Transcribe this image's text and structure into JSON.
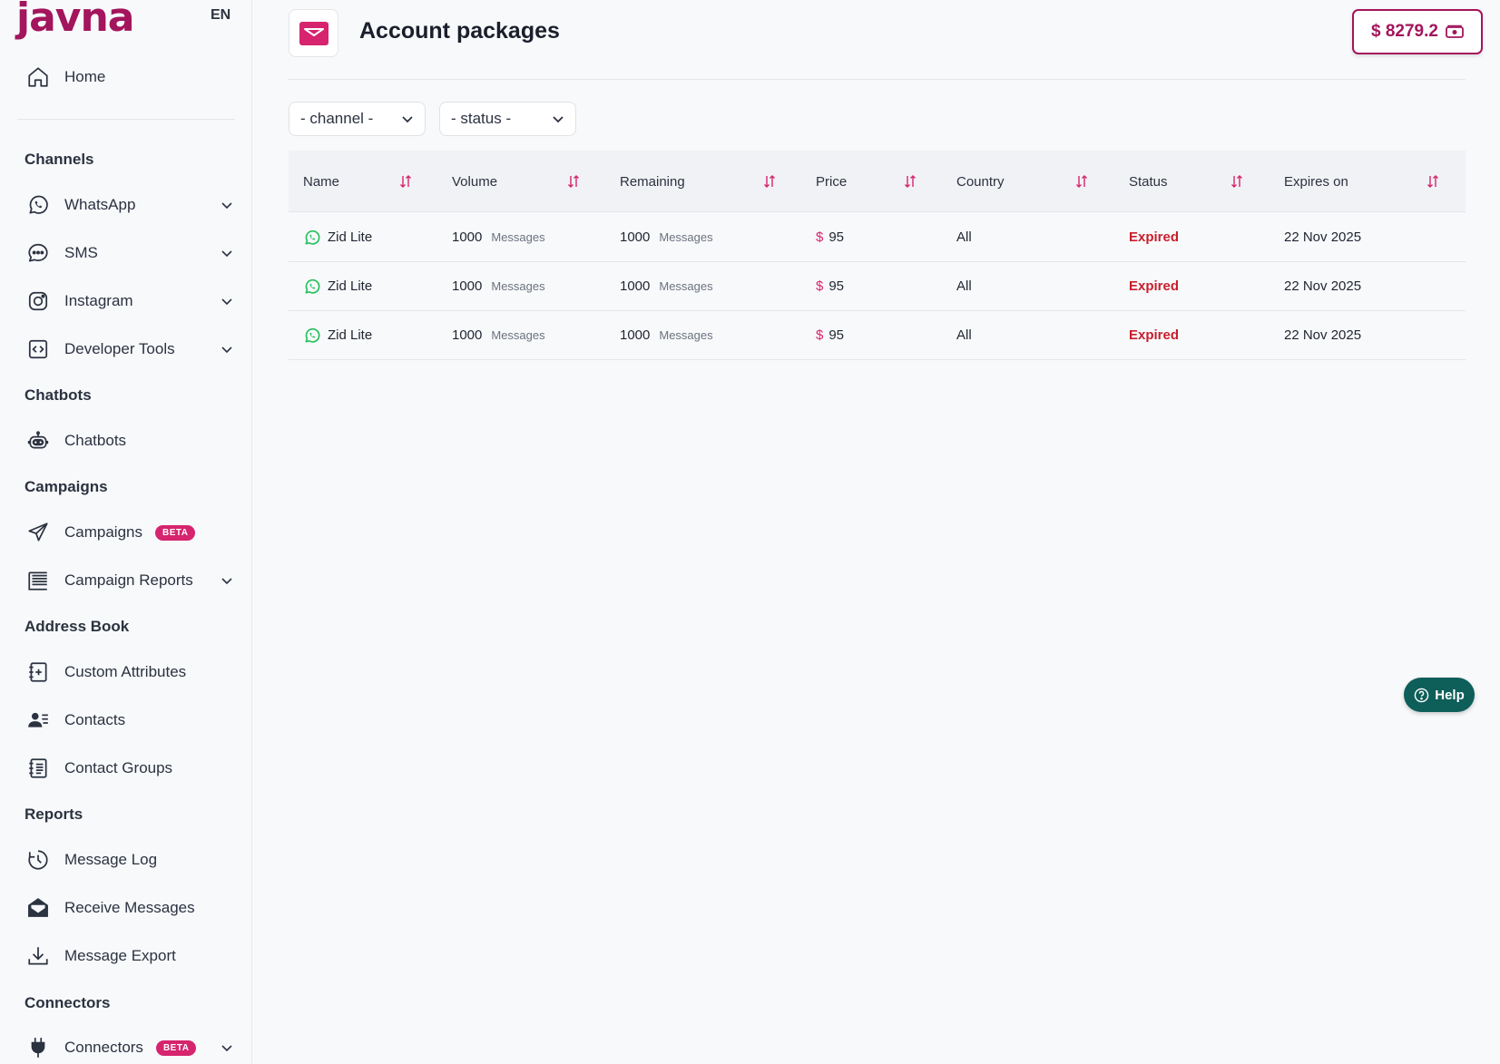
{
  "brand": {
    "logo_text": "javna",
    "language": "EN",
    "accent": "#a3155c",
    "pink": "#d6246e",
    "help_color": "#0e5e5a"
  },
  "sidebar": {
    "home": "Home",
    "sections": {
      "channels": "Channels",
      "chatbots": "Chatbots",
      "campaigns": "Campaigns",
      "address_book": "Address Book",
      "reports": "Reports",
      "connectors": "Connectors"
    },
    "items": {
      "whatsapp": "WhatsApp",
      "sms": "SMS",
      "instagram": "Instagram",
      "developer_tools": "Developer Tools",
      "chatbots": "Chatbots",
      "campaigns": "Campaigns",
      "campaign_reports": "Campaign Reports",
      "custom_attributes": "Custom Attributes",
      "contacts": "Contacts",
      "contact_groups": "Contact Groups",
      "message_log": "Message Log",
      "receive_messages": "Receive Messages",
      "message_export": "Message Export",
      "connectors": "Connectors"
    },
    "beta_label": "BETA"
  },
  "header": {
    "title": "Account packages",
    "balance": "$ 8279.2"
  },
  "filters": {
    "channel": "- channel -",
    "status": "- status -"
  },
  "table": {
    "columns": [
      "Name",
      "Volume",
      "Remaining",
      "Price",
      "Country",
      "Status",
      "Expires on"
    ],
    "rows": [
      {
        "name": "Zid Lite",
        "volume": "1000",
        "volume_unit": "Messages",
        "remaining": "1000",
        "remaining_unit": "Messages",
        "currency": "$",
        "price": "95",
        "country": "All",
        "status": "Expired",
        "expires": "22 Nov 2025"
      },
      {
        "name": "Zid Lite",
        "volume": "1000",
        "volume_unit": "Messages",
        "remaining": "1000",
        "remaining_unit": "Messages",
        "currency": "$",
        "price": "95",
        "country": "All",
        "status": "Expired",
        "expires": "22 Nov 2025"
      },
      {
        "name": "Zid Lite",
        "volume": "1000",
        "volume_unit": "Messages",
        "remaining": "1000",
        "remaining_unit": "Messages",
        "currency": "$",
        "price": "95",
        "country": "All",
        "status": "Expired",
        "expires": "22 Nov 2025"
      }
    ]
  },
  "help": {
    "label": "Help"
  }
}
